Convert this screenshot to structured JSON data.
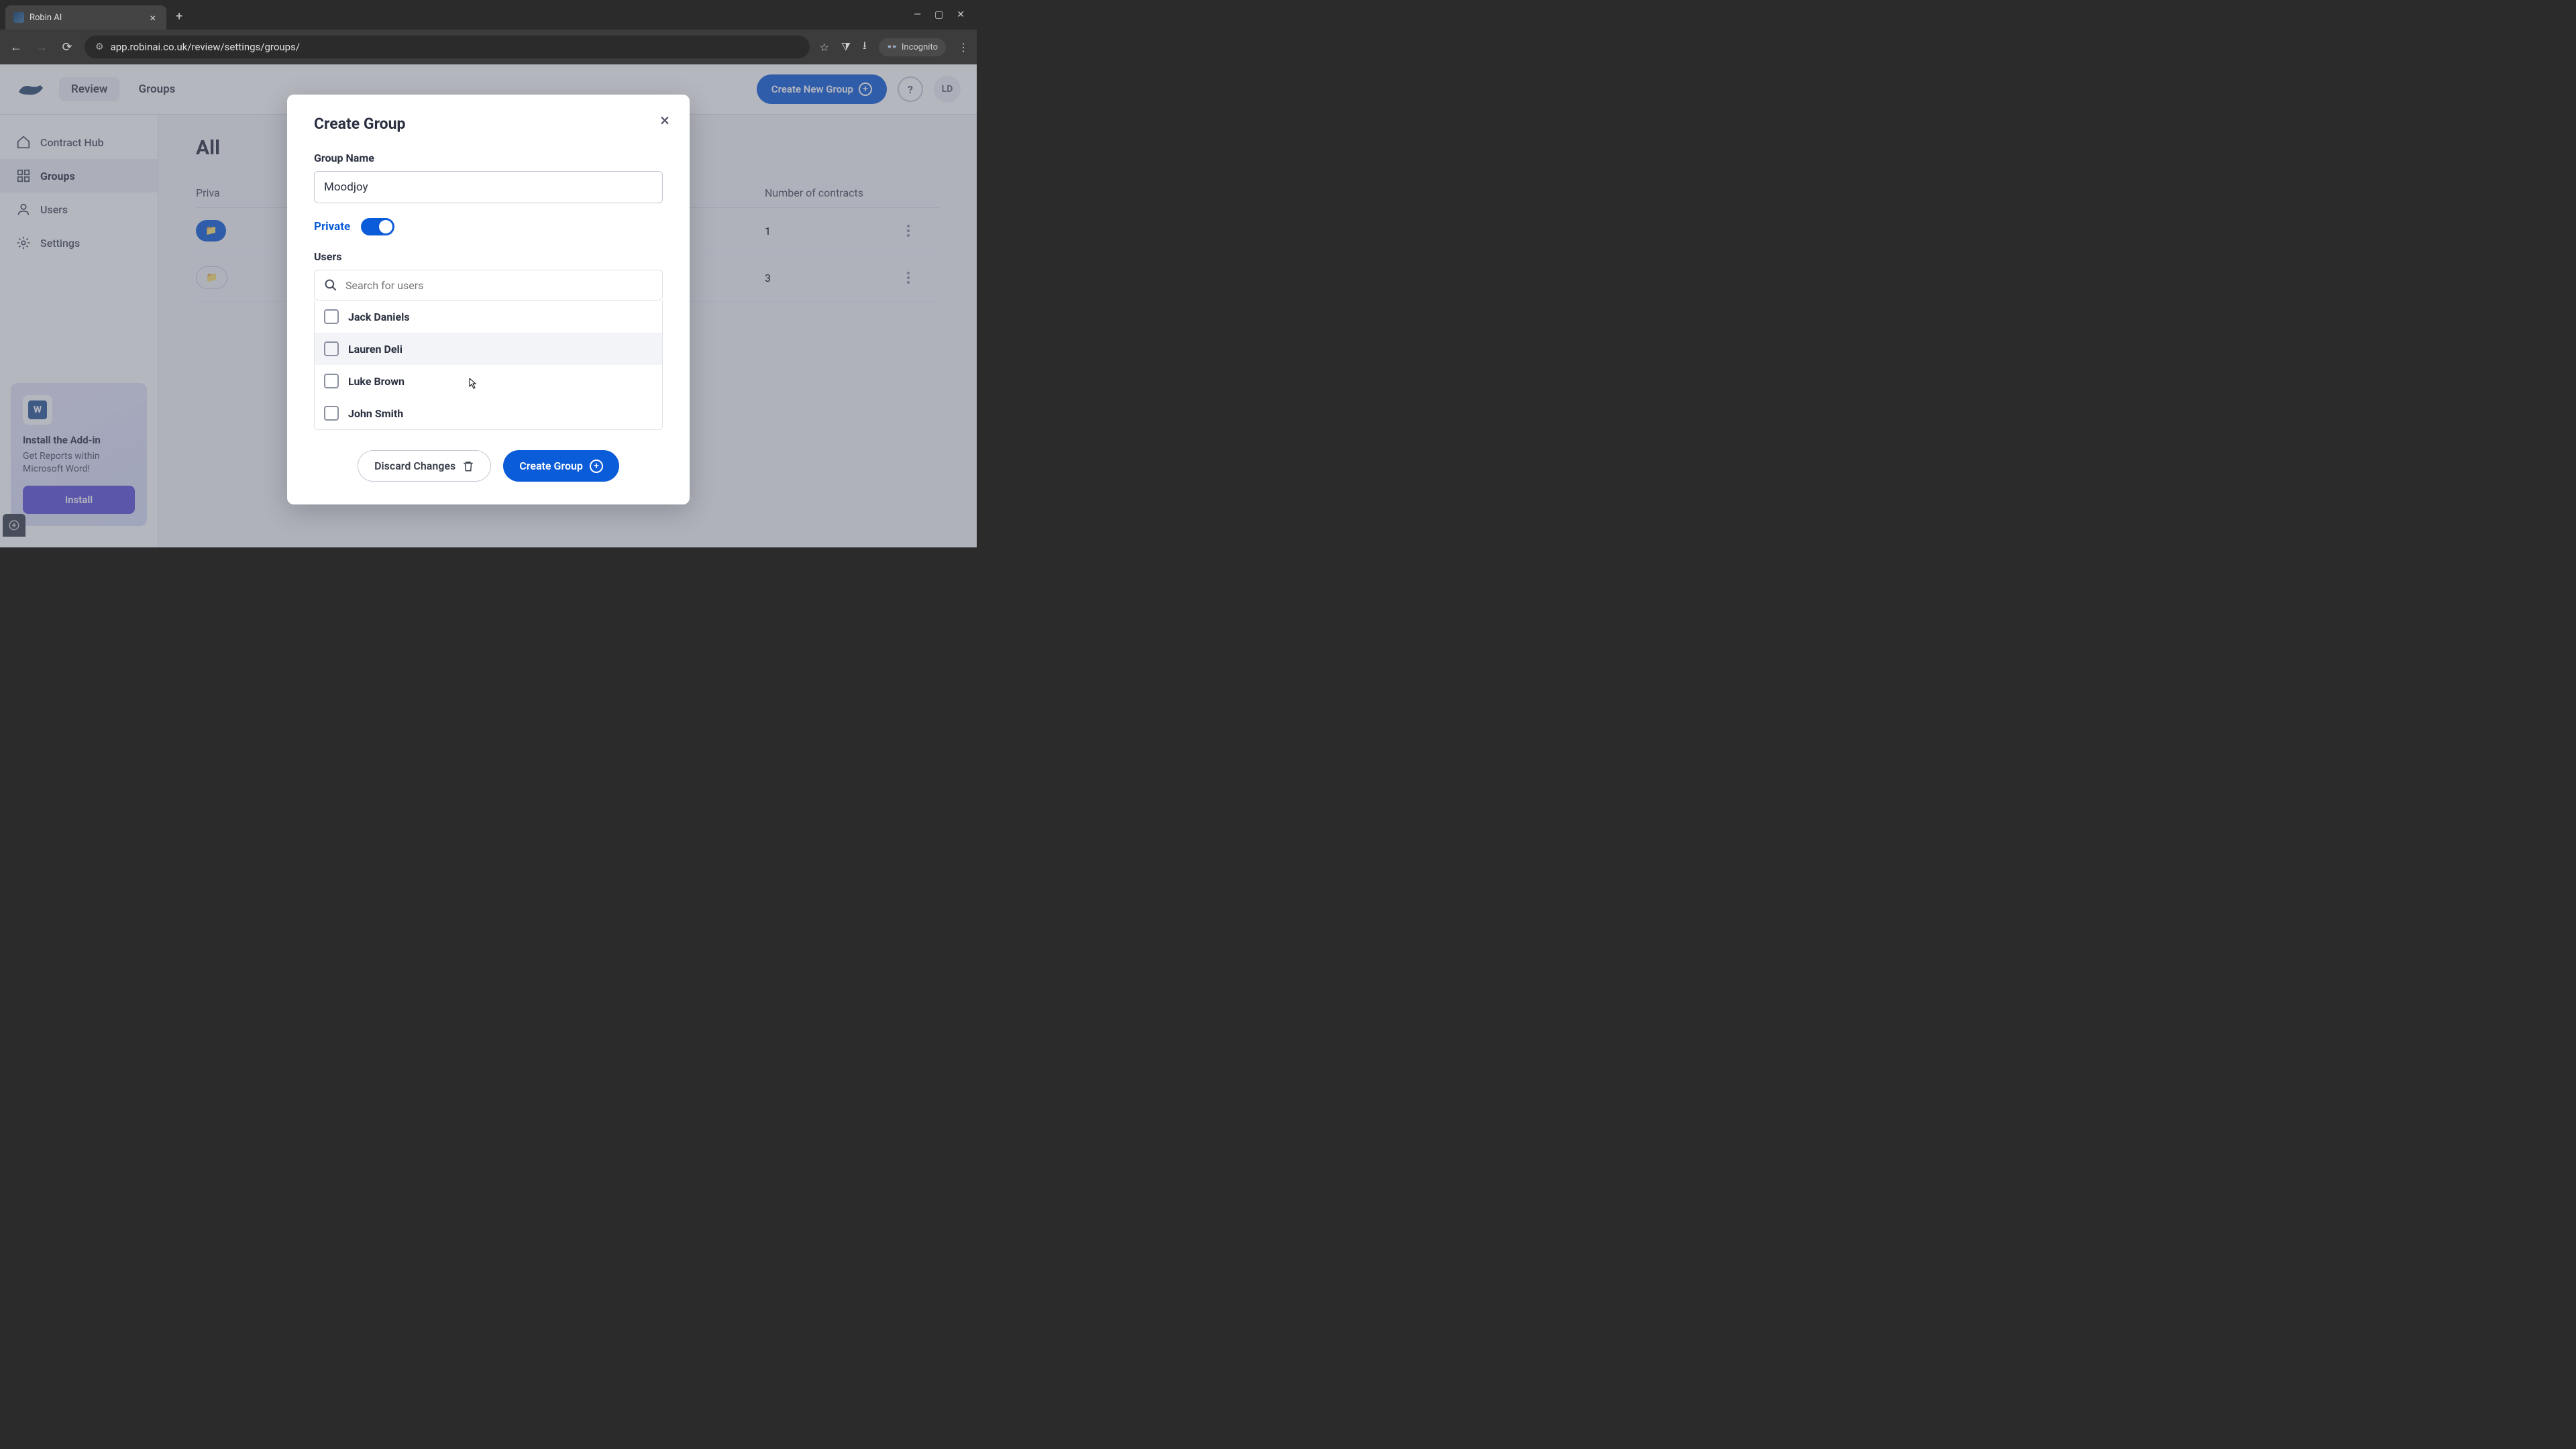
{
  "browser": {
    "tab_title": "Robin AI",
    "url": "app.robinai.co.uk/review/settings/groups/",
    "incognito_label": "Incognito"
  },
  "header": {
    "tabs": {
      "review": "Review",
      "groups": "Groups"
    },
    "create_btn": "Create New Group",
    "help": "?",
    "avatar": "LD"
  },
  "sidebar": {
    "items": {
      "contract_hub": "Contract Hub",
      "groups": "Groups",
      "users": "Users",
      "settings": "Settings"
    },
    "addin": {
      "title": "Install the Add-in",
      "desc": "Get Reports within Microsoft Word!",
      "btn": "Install"
    }
  },
  "main": {
    "title": "All",
    "columns": {
      "privacy": "Priva",
      "contracts": "Number of contracts"
    },
    "rows": [
      {
        "contracts": "1"
      },
      {
        "contracts": "3"
      }
    ]
  },
  "modal": {
    "title": "Create Group",
    "group_name_label": "Group Name",
    "group_name_value": "Moodjoy",
    "private_label": "Private",
    "users_label": "Users",
    "search_placeholder": "Search for users",
    "users": [
      {
        "name": "Jack Daniels"
      },
      {
        "name": "Lauren Deli"
      },
      {
        "name": "Luke Brown"
      },
      {
        "name": "John Smith"
      }
    ],
    "discard_btn": "Discard Changes",
    "create_btn": "Create Group"
  }
}
